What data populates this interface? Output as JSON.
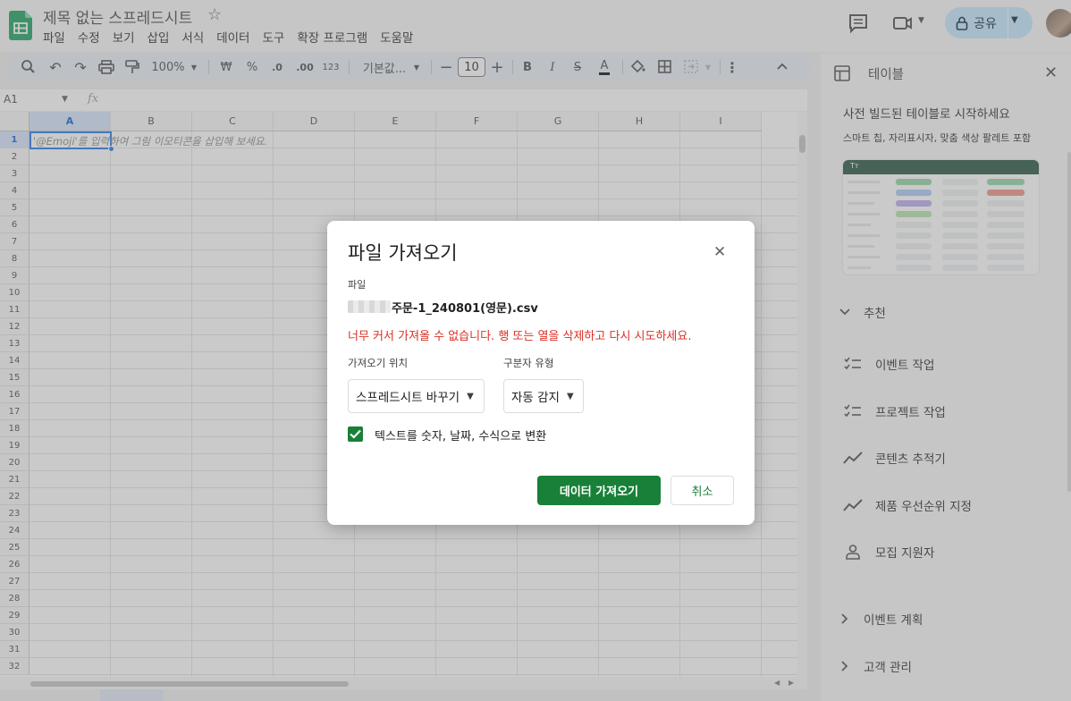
{
  "app": {
    "doc_title": "제목 없는 스프레드시트",
    "menu": [
      "파일",
      "수정",
      "보기",
      "삽입",
      "서식",
      "데이터",
      "도구",
      "확장 프로그램",
      "도움말"
    ],
    "share_label": "공유"
  },
  "toolbar": {
    "zoom": "100%",
    "currency": "₩",
    "percent": "%",
    "decrease_decimal": ".0",
    "increase_decimal": ".00",
    "number_format": "123",
    "font": "기본값...",
    "font_size": "10",
    "bold": "B",
    "italic": "I",
    "strike": "S",
    "text_color": "A"
  },
  "formula_bar": {
    "cell_ref": "A1",
    "fx": "fx"
  },
  "grid": {
    "columns": [
      "A",
      "B",
      "C",
      "D",
      "E",
      "F",
      "G",
      "H",
      "I"
    ],
    "rows": [
      "1",
      "2",
      "3",
      "4",
      "5",
      "6",
      "7",
      "8",
      "9",
      "10",
      "11",
      "12",
      "13",
      "14",
      "15",
      "16",
      "17",
      "18",
      "19",
      "20",
      "21",
      "22",
      "23",
      "24",
      "25",
      "26",
      "27",
      "28",
      "29",
      "30",
      "31",
      "32"
    ],
    "a1_hint": "'@Emoji'를 입력하여 그림 이모티콘을 삽입해 보세요."
  },
  "side_panel": {
    "title": "테이블",
    "heading": "사전 빌드된 테이블로 시작하세요",
    "subheading": "스마트 칩, 자리표시자, 맞춤 색상 팔레트 포함",
    "preview_header_glyph": "Tт",
    "recommended_label": "추천",
    "items": [
      {
        "label": "이벤트 작업",
        "icon": "checklist-icon"
      },
      {
        "label": "프로젝트 작업",
        "icon": "checklist-icon"
      },
      {
        "label": "콘텐츠 추적기",
        "icon": "trending-icon"
      },
      {
        "label": "제품 우선순위 지정",
        "icon": "trending-icon"
      },
      {
        "label": "모집 지원자",
        "icon": "person-icon"
      }
    ],
    "sections": [
      "이벤트 계획",
      "고객 관리"
    ]
  },
  "dialog": {
    "title": "파일 가져오기",
    "file_label": "파일",
    "file_name": "주문-1_240801(영문).csv",
    "error": "너무 커서 가져올 수 없습니다. 행 또는 열을 삭제하고 다시 시도하세요.",
    "import_location_label": "가져오기 위치",
    "import_location_value": "스프레드시트 바꾸기",
    "separator_label": "구분자 유형",
    "separator_value": "자동 감지",
    "convert_checkbox_label": "텍스트를 숫자, 날짜, 수식으로 변환",
    "convert_checked": true,
    "import_button": "데이터 가져오기",
    "cancel_button": "취소"
  },
  "colors": {
    "accent_green": "#188038",
    "error_red": "#d93025",
    "share_blue": "#c2e7ff",
    "selection_blue": "#1a73e8"
  }
}
